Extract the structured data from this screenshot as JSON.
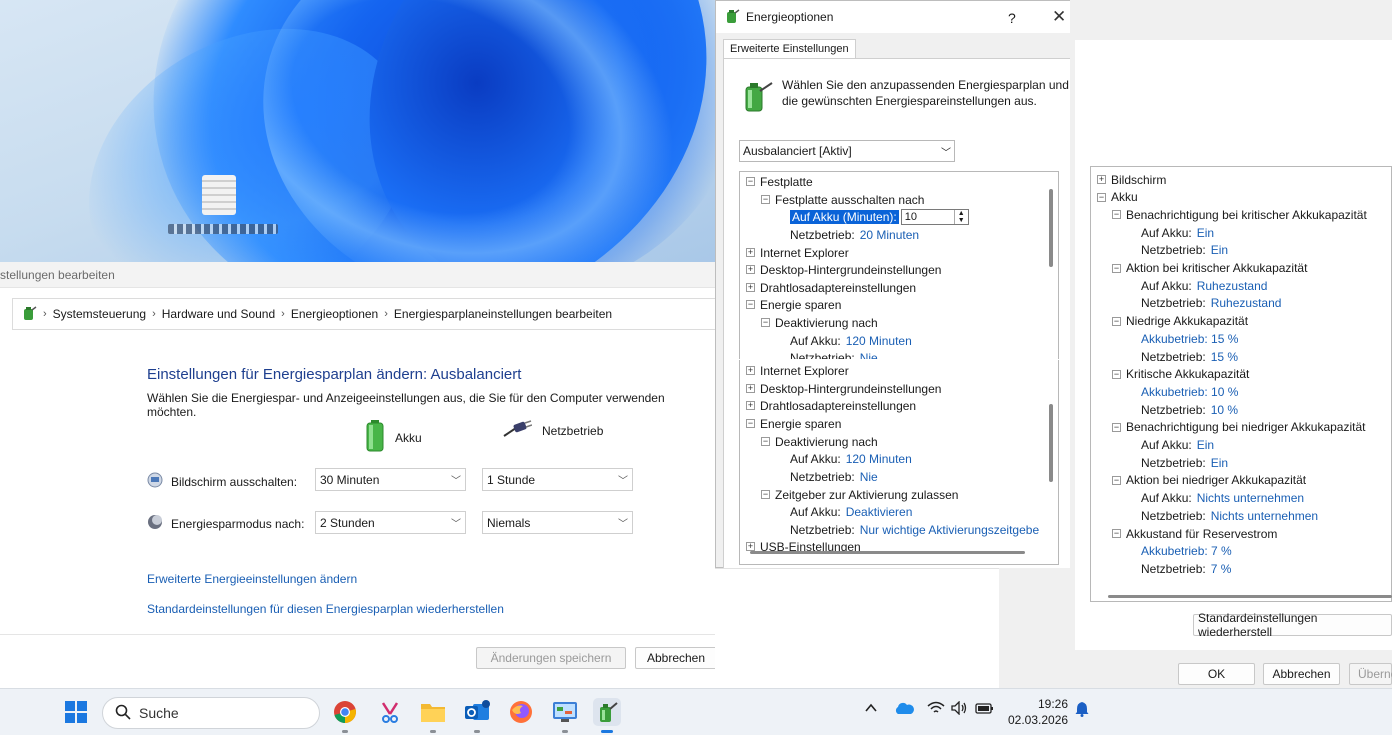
{
  "control_panel": {
    "window_title_partial": "stellungen bearbeiten",
    "breadcrumb": [
      "Systemsteuerung",
      "Hardware und Sound",
      "Energieoptionen",
      "Energiesparplaneinstellungen bearbeiten"
    ],
    "heading": "Einstellungen für Energiesparplan ändern: Ausbalanciert",
    "description": "Wählen Sie die Energiespar- und Anzeigeeinstellungen aus, die Sie für den Computer verwenden möchten.",
    "col_battery": "Akku",
    "col_plugged": "Netzbetrieb",
    "rows": [
      {
        "label": "Bildschirm ausschalten:",
        "battery": "30 Minuten",
        "plugged": "1 Stunde"
      },
      {
        "label": "Energiesparmodus nach:",
        "battery": "2 Stunden",
        "plugged": "Niemals"
      }
    ],
    "link_advanced": "Erweiterte Energieeinstellungen ändern",
    "link_restore": "Standardeinstellungen für diesen Energiesparplan wiederherstellen",
    "btn_save": "Änderungen speichern",
    "btn_cancel": "Abbrechen"
  },
  "dialog": {
    "title": "Energieoptionen",
    "help": "?",
    "close": "✕",
    "tab": "Erweiterte Einstellungen",
    "intro": "Wählen Sie den anzupassenden Energiesparplan und die gewünschten Energiespareinstellungen aus.",
    "plan": "Ausbalanciert [Aktiv]",
    "tree1": {
      "festplatte": "Festplatte",
      "festplatte_aus": "Festplatte ausschalten nach",
      "auf_akku_minuten": "Auf Akku (Minuten):",
      "spin_value": "10",
      "netz_label": "Netzbetrieb:",
      "netz_value": "20 Minuten",
      "ie": "Internet Explorer",
      "desktop": "Desktop-Hintergrundeinstellungen",
      "drahtlos": "Drahtlosadaptereinstellungen",
      "energie_sparen": "Energie sparen",
      "deaktivierung": "Deaktivierung nach",
      "auf_akku": "Auf Akku:",
      "deakt_akku": "120 Minuten",
      "netzbetrieb": "Netzbetrieb:",
      "deakt_netz": "Nie"
    },
    "tree2": {
      "ie": "Internet Explorer",
      "desktop": "Desktop-Hintergrundeinstellungen",
      "drahtlos": "Drahtlosadaptereinstellungen",
      "energie_sparen": "Energie sparen",
      "deaktivierung": "Deaktivierung nach",
      "auf_akku": "Auf Akku:",
      "deakt_akku": "120 Minuten",
      "netzbetrieb": "Netzbetrieb:",
      "deakt_netz": "Nie",
      "zeitgeber": "Zeitgeber zur Aktivierung zulassen",
      "zeit_akku": "Deaktivieren",
      "zeit_netz": "Nur wichtige Aktivierungszeitgebe",
      "usb": "USB-Einstellungen"
    }
  },
  "right_dialog": {
    "tree": [
      {
        "level": 0,
        "box": "+",
        "text": "Bildschirm"
      },
      {
        "level": 0,
        "box": "−",
        "text": "Akku"
      },
      {
        "level": 1,
        "box": "−",
        "text": "Benachrichtigung bei kritischer Akkukapazität"
      },
      {
        "level": 2,
        "label": "Auf Akku:",
        "value": "Ein"
      },
      {
        "level": 2,
        "label": "Netzbetrieb:",
        "value": "Ein"
      },
      {
        "level": 1,
        "box": "−",
        "text": "Aktion bei kritischer Akkukapazität"
      },
      {
        "level": 2,
        "label": "Auf Akku:",
        "value": "Ruhezustand"
      },
      {
        "level": 2,
        "label": "Netzbetrieb:",
        "value": "Ruhezustand"
      },
      {
        "level": 1,
        "box": "−",
        "text": "Niedrige Akkukapazität"
      },
      {
        "level": 2,
        "label": "",
        "value": "Akkubetrieb: 15 %"
      },
      {
        "level": 2,
        "label": "Netzbetrieb:",
        "value": "15 %"
      },
      {
        "level": 1,
        "box": "−",
        "text": "Kritische Akkukapazität"
      },
      {
        "level": 2,
        "label": "",
        "value": "Akkubetrieb: 10 %"
      },
      {
        "level": 2,
        "label": "Netzbetrieb:",
        "value": "10 %"
      },
      {
        "level": 1,
        "box": "−",
        "text": "Benachrichtigung bei niedriger Akkukapazität"
      },
      {
        "level": 2,
        "label": "Auf Akku:",
        "value": "Ein"
      },
      {
        "level": 2,
        "label": "Netzbetrieb:",
        "value": "Ein"
      },
      {
        "level": 1,
        "box": "−",
        "text": "Aktion bei niedriger Akkukapazität"
      },
      {
        "level": 2,
        "label": "Auf Akku:",
        "value": "Nichts unternehmen"
      },
      {
        "level": 2,
        "label": "Netzbetrieb:",
        "value": "Nichts unternehmen"
      },
      {
        "level": 1,
        "box": "−",
        "text": "Akkustand für Reservestrom"
      },
      {
        "level": 2,
        "label": "",
        "value": "Akkubetrieb: 7 %"
      },
      {
        "level": 2,
        "label": "Netzbetrieb:",
        "value": "7 %"
      }
    ],
    "btn_restore": "Standardeinstellungen wiederherstell",
    "btn_ok": "OK",
    "btn_cancel": "Abbrechen",
    "btn_apply_partial": "Überne"
  },
  "taskbar": {
    "search_placeholder": "Suche",
    "time": "19:26",
    "date": "02.03.2026",
    "apps": [
      "start-icon",
      "chrome-icon",
      "snipping-tool-icon",
      "file-explorer-icon",
      "outlook-icon",
      "firefox-icon",
      "control-panel-icon",
      "power-options-icon"
    ]
  }
}
